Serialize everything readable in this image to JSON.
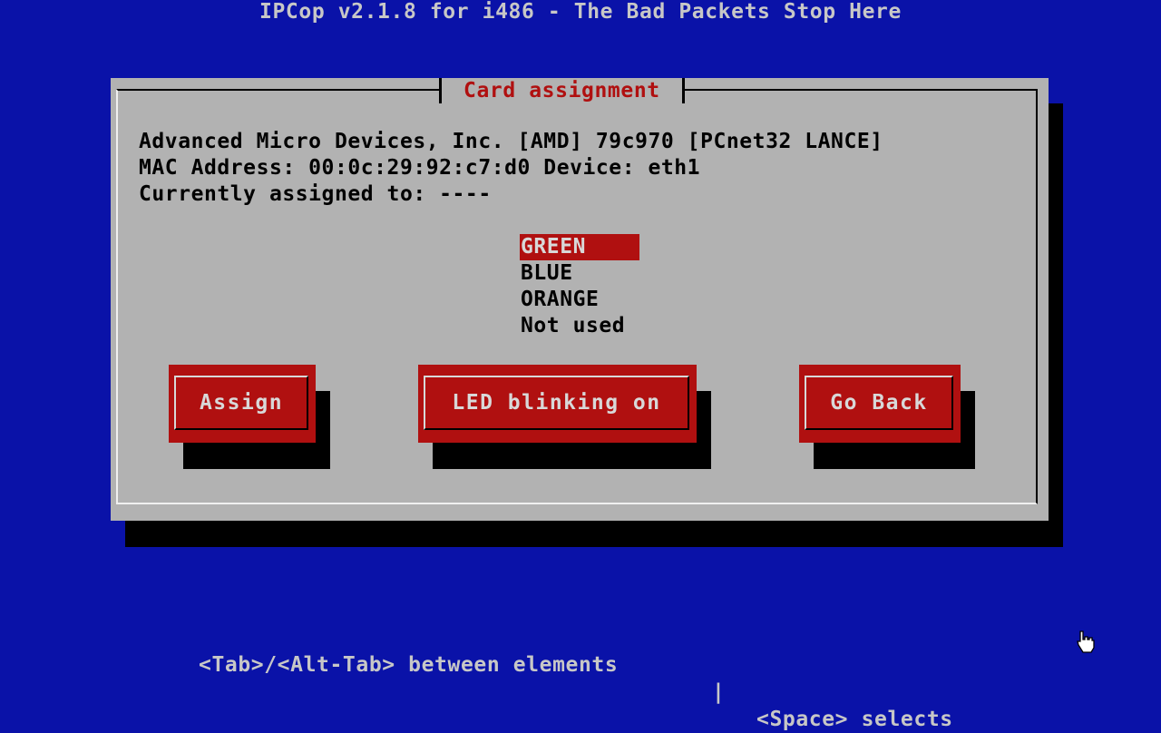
{
  "header": {
    "title": "IPCop v2.1.8 for i486 - The Bad Packets Stop Here"
  },
  "dialog": {
    "title": "Card assignment",
    "device_line": "Advanced Micro Devices, Inc. [AMD] 79c970 [PCnet32 LANCE]",
    "mac_line": "MAC Address: 00:0c:29:92:c7:d0 Device: eth1",
    "assigned_line": "Currently assigned to: ----",
    "zones": [
      "GREEN",
      "BLUE",
      "ORANGE",
      "Not used"
    ],
    "selected_zone": "GREEN",
    "buttons": {
      "assign": "Assign",
      "led": "LED blinking on",
      "back": "Go Back"
    }
  },
  "footer": {
    "hint_left": "<Tab>/<Alt-Tab> between elements",
    "separator": "|",
    "hint_right": "<Space> selects"
  },
  "colors": {
    "background": "#0a12a8",
    "dialog": "#b2b2b2",
    "accent": "#b01010",
    "text_light": "#c7c7c7"
  },
  "icons": {
    "cursor": "hand-pointer-icon"
  }
}
